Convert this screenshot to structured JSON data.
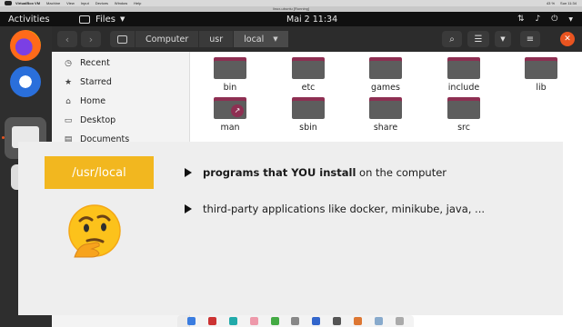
{
  "mac_menubar": {
    "app": "VirtualBox VM",
    "menus": [
      "Machine",
      "View",
      "Input",
      "Devices",
      "Window",
      "Help"
    ],
    "battery": "43 %",
    "clock": "Sun 11:34"
  },
  "vm_window_title": "linux-ubuntu [Running]",
  "gnome_bar": {
    "activities": "Activities",
    "app_menu": "Files",
    "clock": "Mai 2  11:34"
  },
  "file_manager": {
    "path": {
      "segments": [
        "Computer",
        "usr",
        "local"
      ]
    },
    "sidebar": [
      {
        "label": "Recent",
        "icon": "clock-icon"
      },
      {
        "label": "Starred",
        "icon": "star-icon"
      },
      {
        "label": "Home",
        "icon": "home-icon"
      },
      {
        "label": "Desktop",
        "icon": "desktop-folder-icon"
      },
      {
        "label": "Documents",
        "icon": "documents-folder-icon"
      }
    ],
    "folders": [
      {
        "name": "bin",
        "symlink": false
      },
      {
        "name": "etc",
        "symlink": false
      },
      {
        "name": "games",
        "symlink": false
      },
      {
        "name": "include",
        "symlink": false
      },
      {
        "name": "lib",
        "symlink": false
      },
      {
        "name": "man",
        "symlink": true
      },
      {
        "name": "sbin",
        "symlink": false
      },
      {
        "name": "share",
        "symlink": false
      },
      {
        "name": "src",
        "symlink": false
      }
    ]
  },
  "slide": {
    "tag": "/usr/local",
    "bullet1_bold": "programs that YOU install",
    "bullet1_rest": " on the computer",
    "bullet2": "third-party applications like docker, minikube, java, ...",
    "emoji": "thinking-face-icon"
  },
  "colors": {
    "tag_yellow": "#f2b71f",
    "folder_accent": "#8e2f52",
    "ubuntu_orange": "#e95420"
  }
}
